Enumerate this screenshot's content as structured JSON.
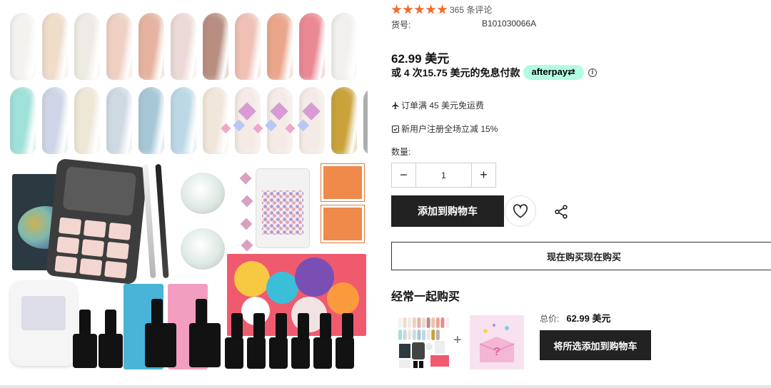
{
  "product": {
    "image_alt": "product-image",
    "rating": {
      "stars": 5,
      "count_text": "365 条评论"
    },
    "sku": {
      "label": "货号:",
      "value": "B101030066A"
    },
    "price": "62.99 美元",
    "installment": {
      "text": "或 4 次15.75 美元的免息付款",
      "badge": "afterpay"
    },
    "perks": [
      {
        "icon": "plane-icon",
        "text": "订单满 45 美元免运费"
      },
      {
        "icon": "checkbox-icon",
        "text": "新用户注册全场立减 15%"
      }
    ],
    "quantity": {
      "label": "数量:",
      "value": "1",
      "minus": "−",
      "plus": "+"
    },
    "add_to_cart_label": "添加到购物车",
    "buy_now_label": "现在购买现在购买"
  },
  "bought_together": {
    "title": "经常一起购买",
    "plus": "+",
    "total_label": "总价:",
    "total_value": "62.99 美元",
    "add_all_label": "将所选添加到购物车"
  },
  "colors": {
    "accent_star": "#f56a2a",
    "afterpay_badge": "#b2fce4",
    "primary_button": "#222222"
  },
  "nail_colors_row1": [
    "#f4f2ef",
    "#efdcc9",
    "#eeebe4",
    "#efd0c2",
    "#e6b3a0",
    "#ead9d6",
    "#b88e80",
    "#efc0b3",
    "#eaa68b",
    "#ea8893",
    "#f1f0ee"
  ],
  "nail_colors_row2": [
    "#9fe1d8",
    "#cfd5e6",
    "#ede7d6",
    "#cfd9e2",
    "#a7c7d6",
    "#bcd8e6",
    "#f0e6d9",
    "rhine",
    "rhine",
    "rhine",
    "#caa23a",
    "#b3b3b3"
  ]
}
